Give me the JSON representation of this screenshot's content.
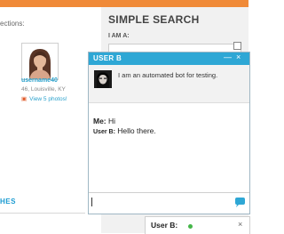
{
  "background": {
    "top_strip_text": "",
    "left": {
      "section_label": "ections:",
      "profile": {
        "username": "username40",
        "location": "46, Louisville, KY",
        "photos_link": "View 5 photos!"
      },
      "bottom_heading": "HES"
    },
    "right": {
      "title": "SIMPLE SEARCH",
      "iam_label": "I AM A:"
    }
  },
  "chat": {
    "title": "USER B",
    "minimize_label": "—",
    "close_label": "×",
    "bot_description": "I am an automated bot for testing.",
    "messages": [
      {
        "sender": "Me:",
        "text": "Hi"
      },
      {
        "sender": "User B:",
        "text": "Hello there."
      }
    ],
    "input_value": "",
    "send_icon": "speech-bubble-icon"
  },
  "chat_tab": {
    "title": "User B:",
    "status": "online",
    "close_label": "×"
  },
  "colors": {
    "accent": "#2ea7d5",
    "orange": "#f08a38",
    "online": "#45b649"
  }
}
